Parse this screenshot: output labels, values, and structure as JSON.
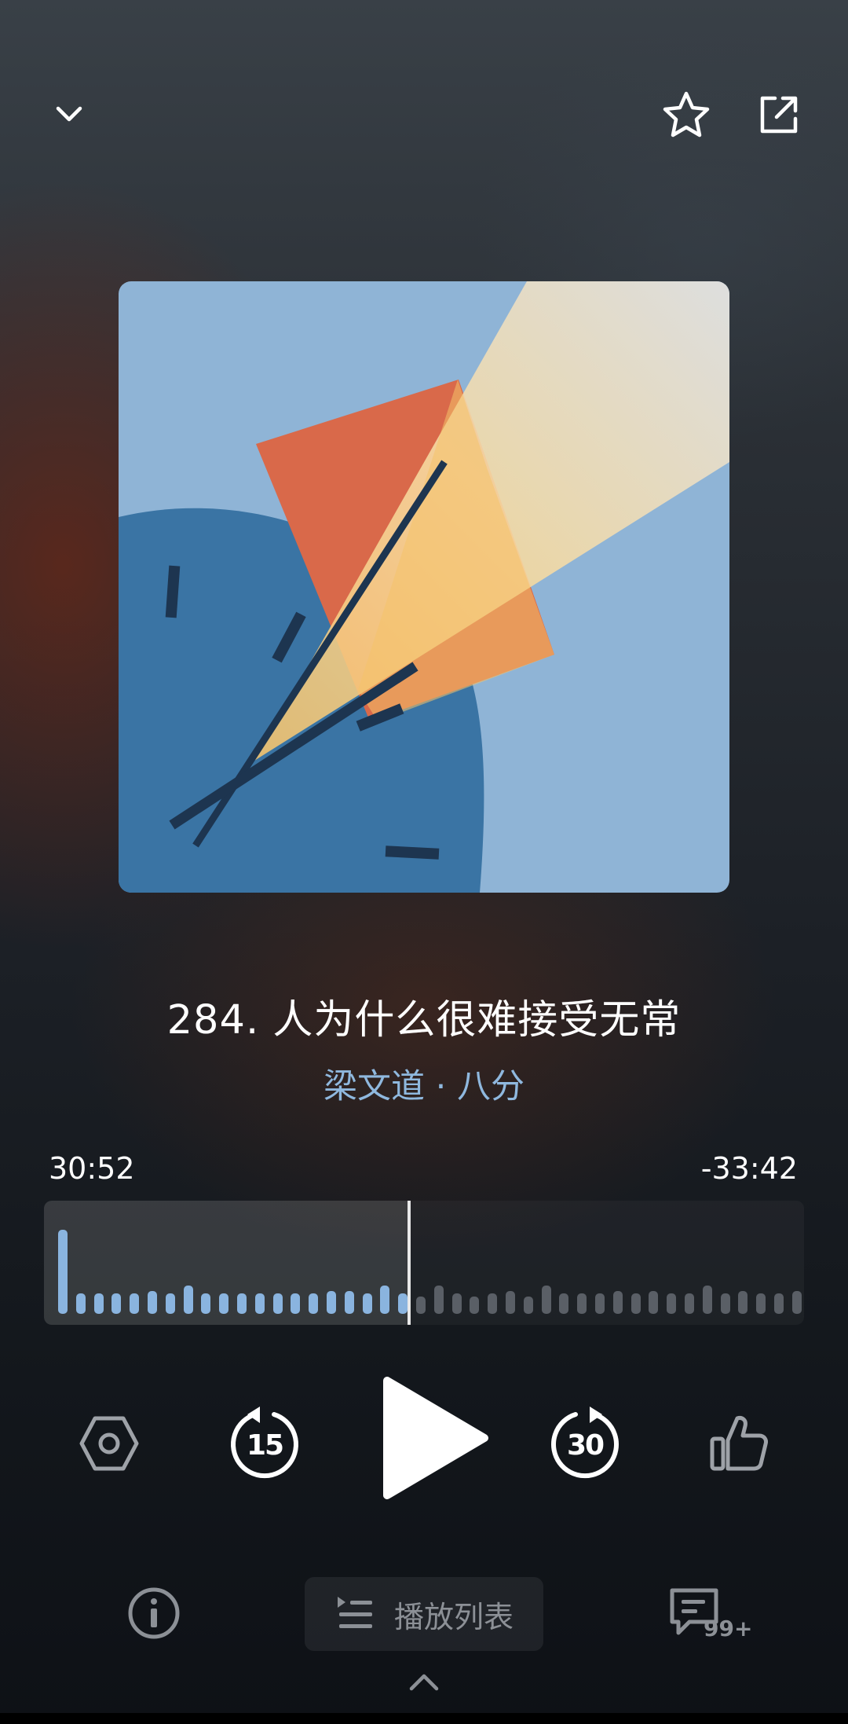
{
  "header": {
    "collapse_icon": "chevron-down-icon",
    "favorite_icon": "star-icon",
    "share_icon": "share-external-icon"
  },
  "episode": {
    "title": "284. 人为什么很难接受无常",
    "subtitle": "梁文道 · 八分"
  },
  "progress": {
    "elapsed": "30:52",
    "remaining": "-33:42",
    "played_fraction": 0.48
  },
  "waveform": {
    "levels": [
      0.82,
      0.2,
      0.2,
      0.2,
      0.2,
      0.22,
      0.2,
      0.28,
      0.2,
      0.2,
      0.2,
      0.2,
      0.2,
      0.2,
      0.2,
      0.22,
      0.22,
      0.2,
      0.28,
      0.2,
      0.17,
      0.28,
      0.2,
      0.17,
      0.2,
      0.22,
      0.17,
      0.28,
      0.2,
      0.2,
      0.2,
      0.22,
      0.2,
      0.22,
      0.2,
      0.2,
      0.28,
      0.2,
      0.22,
      0.2,
      0.2,
      0.22,
      0.28,
      0.2,
      0.28
    ],
    "played_color": "#8ab4df",
    "unplayed_color": "#5a5f66"
  },
  "controls": {
    "speed_icon": "hexagon-settings-icon",
    "rewind_seconds": "15",
    "forward_seconds": "30",
    "play_icon": "play-icon",
    "like_icon": "thumbs-up-icon"
  },
  "bottom_bar": {
    "info_icon": "info-icon",
    "playlist_label": "播放列表",
    "comments_count": "99+",
    "expand_icon": "chevron-up-icon"
  },
  "colors": {
    "accent_blue": "#8fb8de",
    "cover_bg": "#8fb4d6",
    "cover_clock": "#3a74a4",
    "cover_orange": "#d9694a",
    "cover_light": "#f4efe4"
  }
}
